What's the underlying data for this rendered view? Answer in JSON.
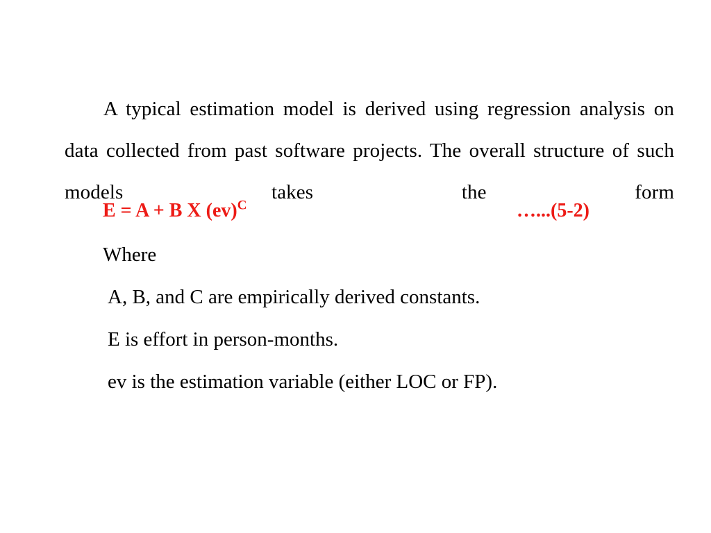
{
  "slide": {
    "background_color": "#ffffff",
    "text_color": "#000000",
    "accent_color": "#ed1b16"
  },
  "paragraph": {
    "text": "A typical estimation model is derived using regression analysis on data collected from past software projects. The overall structure of such models takes the form"
  },
  "formula": {
    "base": "E = A + B X (ev)",
    "exponent": "C",
    "equation_number": "…...(5-2)"
  },
  "where": {
    "label": "Where",
    "definitions": [
      "A, B, and C are empirically derived constants.",
      "E is effort in person-months.",
      "ev is the estimation variable (either LOC or FP)."
    ]
  }
}
